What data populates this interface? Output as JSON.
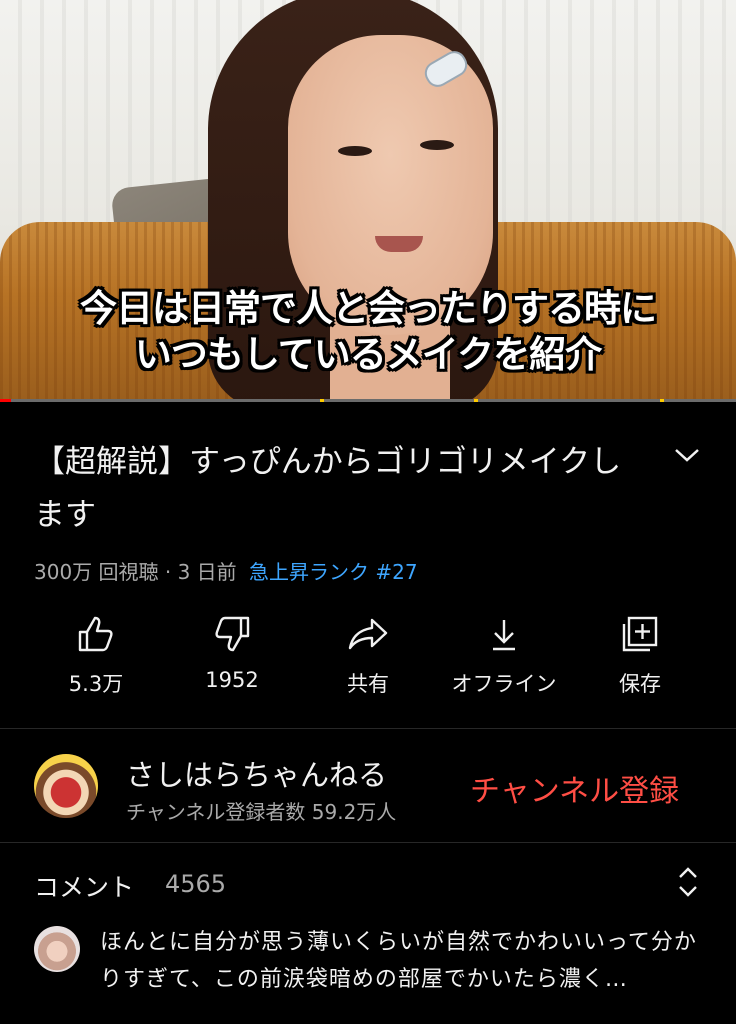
{
  "video": {
    "caption_line1": "今日は日常で人と会ったりする時に",
    "caption_line2": "いつもしているメイクを紹介",
    "progress": 0.015
  },
  "info": {
    "title": "【超解説】すっぴんからゴリゴリメイクします",
    "views": "300万 回視聴 · 3 日前",
    "trending": "急上昇ランク #27",
    "expand_icon": "chevron-down-icon"
  },
  "actions": [
    {
      "icon": "thumbs-up-icon",
      "label": "5.3万"
    },
    {
      "icon": "thumbs-down-icon",
      "label": "1952"
    },
    {
      "icon": "share-icon",
      "label": "共有"
    },
    {
      "icon": "download-icon",
      "label": "オフライン"
    },
    {
      "icon": "save-to-playlist-icon",
      "label": "保存"
    }
  ],
  "channel": {
    "name": "さしはらちゃんねる",
    "subscribers": "チャンネル登録者数 59.2万人",
    "subscribe_label": "チャンネル登録"
  },
  "comments": {
    "label": "コメント",
    "count": "4565",
    "sort_icon": "unfold-icon",
    "top_comment": "ほんとに自分が思う薄いくらいが自然でかわいいって分かりすぎて、この前涙袋暗めの部屋でかいたら濃く…"
  },
  "colors": {
    "background": "#000000",
    "accent_red": "#ff4e45",
    "link_blue": "#3ea6ff",
    "progress_red": "#ff0000"
  }
}
